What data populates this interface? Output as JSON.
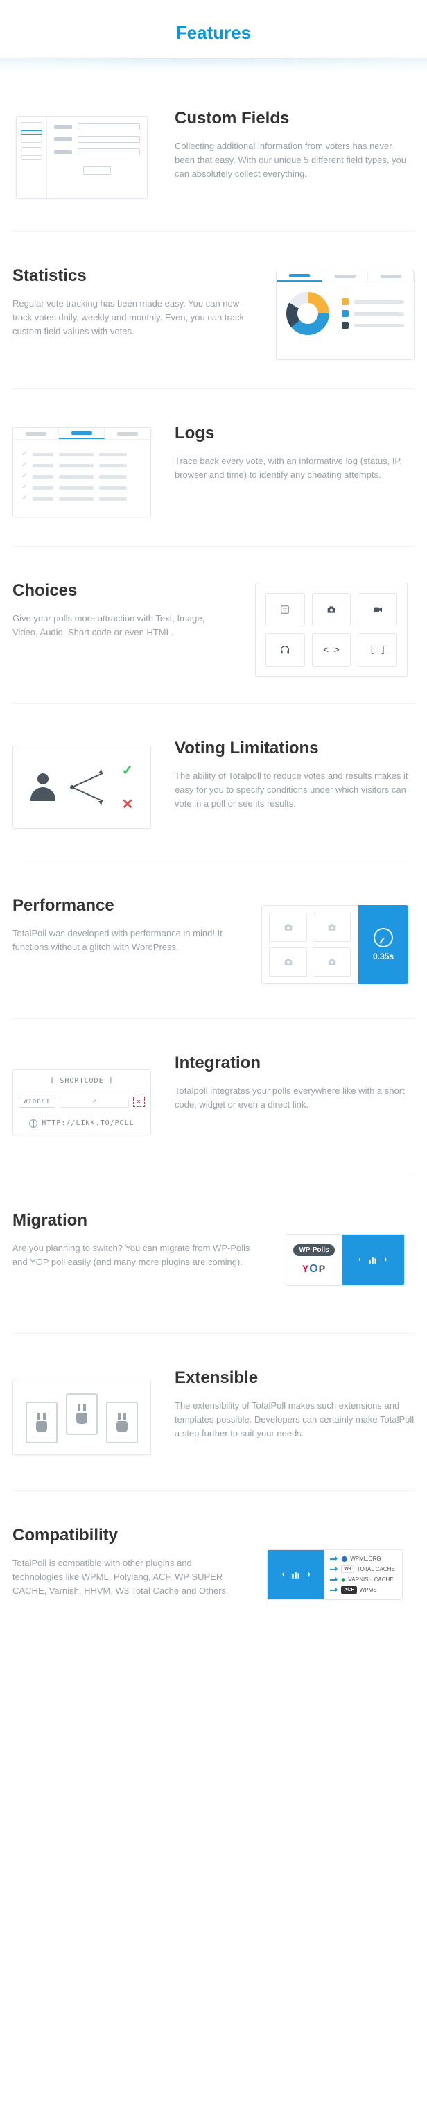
{
  "page_title": "Features",
  "features": {
    "custom_fields": {
      "title": "Custom Fields",
      "body": "Collecting additional information from voters has never been that easy. With our unique 5 different field types, you can absolutely collect everything."
    },
    "statistics": {
      "title": "Statistics",
      "body": "Regular vote tracking has been made easy. You can now track votes daily, weekly and monthly. Even, you can track custom field values with votes.",
      "legend_colors": [
        "#f6b23a",
        "#2a9bd8",
        "#374a5c"
      ]
    },
    "logs": {
      "title": "Logs",
      "body": "Trace back every vote, with an informative log (status, IP, browser and time) to identify any cheating attempts."
    },
    "choices": {
      "title": "Choices",
      "body": "Give your polls more attraction with Text, Image, Video, Audio, Short code or even HTML.",
      "types": [
        "text",
        "image",
        "video",
        "audio",
        "shortcode",
        "html"
      ]
    },
    "voting_limitations": {
      "title": "Voting Limitations",
      "body": "The ability of Totalpoll to reduce votes and results makes it easy for you to specify conditions under which visitors can vote in a poll or see its results."
    },
    "performance": {
      "title": "Performance",
      "body": "TotalPoll was developed with performance in mind! It functions without a glitch with WordPress.",
      "time_label": "0.35s"
    },
    "integration": {
      "title": "Integration",
      "body": "Totalpoll integrates your polls everywhere like with a short code, widget or even a direct link.",
      "shortcode_label": "[ SHORTCODE ]",
      "widget_label": "WIDGET",
      "link_label": "HTTP://LINK.TO/POLL"
    },
    "migration": {
      "title": "Migration",
      "body": "Are you planning to switch? You can migrate from WP-Polls and YOP poll easily (and many more plugins are coming).",
      "wp_polls_badge": "WP-Polls",
      "yop": {
        "y": "Y",
        "o": "O",
        "p": "P"
      }
    },
    "extensible": {
      "title": "Extensible",
      "body": "The extensibility of TotalPoll makes such extensions and templates possible. Developers can certainly make TotalPoll a step further to suit your needs."
    },
    "compatibility": {
      "title": "Compatibility",
      "body": "TotalPoll is compatible with other plugins and technologies like WPML, Polylang, ACF, WP SUPER CACHE, Varnish, HHVM, W3 Total Cache and Others.",
      "items": {
        "wpml": "WPML.ORG",
        "w3": "TOTAL CACHE",
        "varnish": "VARNISH CACHE",
        "acf": "ACF",
        "wpms": "WPMS"
      }
    }
  }
}
